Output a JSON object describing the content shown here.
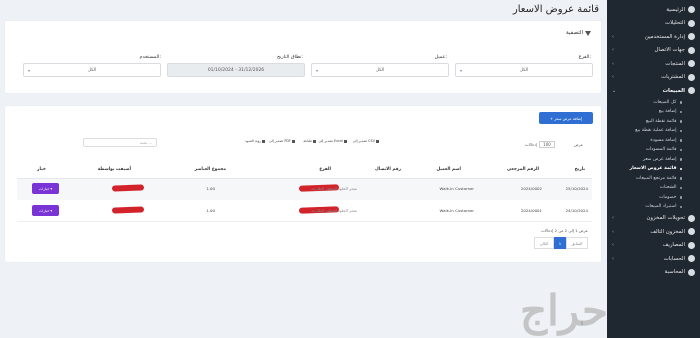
{
  "page_title": "قائمة عروض الاسعار",
  "filter": {
    "title": "التصفية",
    "labels": {
      "branch": "الفرع:",
      "customer": "عميل:",
      "date_range": "نطاق التاريخ:",
      "user": "المستخدم:"
    },
    "values": {
      "branch": "الكل",
      "customer": "الكل",
      "date_range": "01/10/2024 - 31/12/2026",
      "user": "الكل"
    }
  },
  "table": {
    "add_button": "+ إضافة عرض سعر",
    "show_label": "عرض",
    "page_size": "100",
    "entries_label": "إدخالات",
    "tools": [
      "تصدير إلى CSV",
      "تصدير إلى Excel",
      "طباعة",
      "تصدير إلى PDF",
      "رؤية العمود"
    ],
    "search_placeholder": "بحث ...",
    "headers": [
      "تاريخ",
      "الرقم المرجعي",
      "اسم العميل",
      "رقم الاتصال",
      "الفرع",
      "مجموع العناصر",
      "أضيفت بواسطة",
      "خيار"
    ],
    "rows": [
      {
        "date": "25/10/2024",
        "ref": "2024/0002",
        "customer": "Walk-In Customer",
        "branch": "متجر الخلود للعطور الطارجة",
        "total": "1.00",
        "action": "خيارات"
      },
      {
        "date": "24/10/2024",
        "ref": "2024/0001",
        "customer": "Walk-In Customer",
        "branch": "متجر الخلود للعطور الطارجة",
        "total": "1.00",
        "action": "خيارات"
      }
    ],
    "info": "عرض 1 إلى 2 من 2 إدخالات",
    "pagination": {
      "prev": "السابق",
      "current": "1",
      "next": "التالي"
    }
  },
  "sidebar": {
    "items": [
      {
        "label": "الرئيسية",
        "icon": "home-icon"
      },
      {
        "label": "التحليلات",
        "icon": "chart-icon"
      },
      {
        "label": "إدارة المستخدمين",
        "icon": "users-icon"
      },
      {
        "label": "جهات الاتصال",
        "icon": "contacts-icon"
      },
      {
        "label": "المنتجات",
        "icon": "box-icon"
      },
      {
        "label": "المشتريات",
        "icon": "cart-icon"
      },
      {
        "label": "المبيعات",
        "icon": "sales-icon"
      }
    ],
    "sub_items": [
      "كل المبيعات",
      "إضافة بيع",
      "قائمة نقطة البيع",
      "إضافة عملية نقطة بيع",
      "إضافة مسودة",
      "قائمة المسودات",
      "إضافة عرض سعر",
      "قائمة عروض الاسعار",
      "قائمة مرتجع المبيعات",
      "الشحنات",
      "خصومات",
      "استيراد المبيعات"
    ],
    "bottom_items": [
      {
        "label": "تحويلات المخزون",
        "icon": "truck-icon"
      },
      {
        "label": "المخزون التالف",
        "icon": "damaged-icon"
      },
      {
        "label": "المصاريف",
        "icon": "money-icon"
      },
      {
        "label": "الحسابات",
        "icon": "bank-icon"
      },
      {
        "label": "المحاسبة",
        "icon": "accounting-icon"
      }
    ]
  },
  "watermark": "حراج"
}
